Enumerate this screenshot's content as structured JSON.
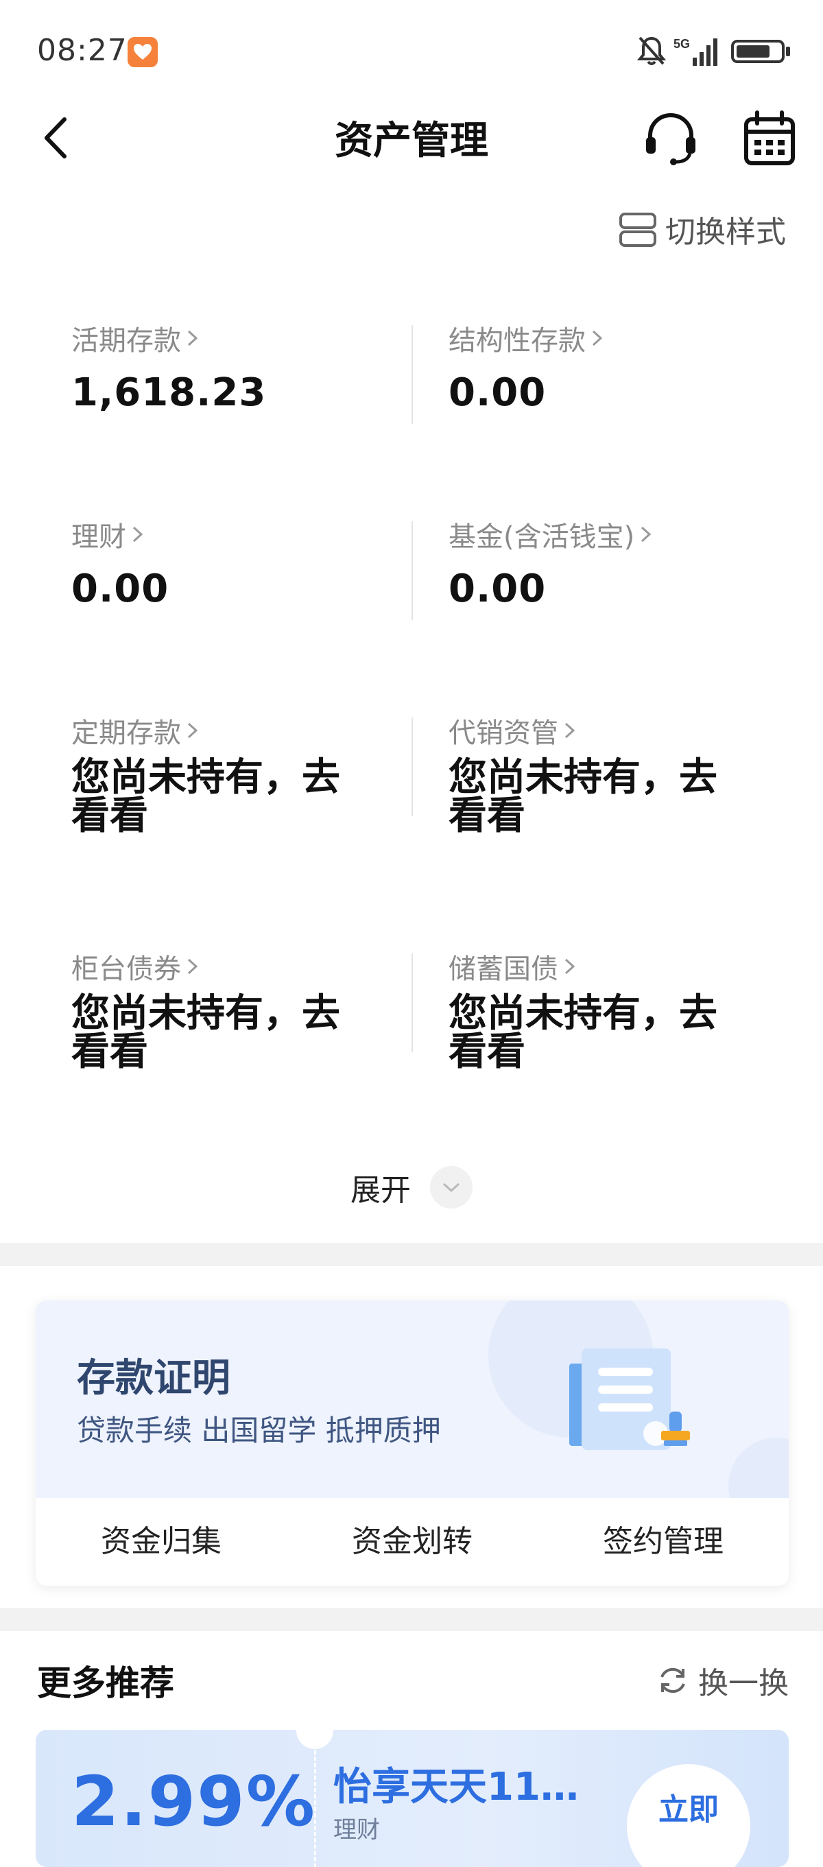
{
  "status_bar": {
    "time": "08:27",
    "network": "5G"
  },
  "header": {
    "title": "资产管理"
  },
  "switch_style": {
    "label": "切换样式"
  },
  "assets": [
    {
      "label": "活期存款",
      "value": "1,618.23"
    },
    {
      "label": "结构性存款",
      "value": "0.00"
    },
    {
      "label": "理财",
      "value": "0.00"
    },
    {
      "label": "基金(含活钱宝)",
      "value": "0.00"
    },
    {
      "label": "定期存款",
      "value": "您尚未持有，去看看"
    },
    {
      "label": "代销资管",
      "value": "您尚未持有，去看看"
    },
    {
      "label": "柜台债券",
      "value": "您尚未持有，去看看"
    },
    {
      "label": "储蓄国债",
      "value": "您尚未持有，去看看"
    }
  ],
  "expand": {
    "label": "展开"
  },
  "deposit_card": {
    "title": "存款证明",
    "subtitle": "贷款手续 出国留学 抵押质押",
    "actions": [
      "资金归集",
      "资金划转",
      "签约管理"
    ]
  },
  "more": {
    "title": "更多推荐",
    "refresh_label": "换一换",
    "promo": {
      "rate": "2.99%",
      "name": "怡享天天11…",
      "type": "理财",
      "button": "立即"
    }
  },
  "colors": {
    "accent": "#2d6ee0",
    "card_bg": "#eef3fd",
    "card_title": "#2f466e"
  }
}
